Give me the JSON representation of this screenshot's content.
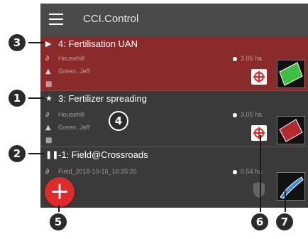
{
  "header": {
    "title": "CCI.Control",
    "menu_icon": "hamburger-menu-icon"
  },
  "tasks": [
    {
      "status_icon": "▶",
      "status_icon_name": "play-icon",
      "title": "4: Fertilisation UAN",
      "customer": "Househill",
      "worker": "Green, Jeff",
      "area": "3.05 ha",
      "selected": true,
      "background": "#8b2a2a",
      "field_color": "#3fbf3f"
    },
    {
      "status_icon": "★",
      "status_icon_name": "star-icon",
      "title": "3: Fertilizer spreading",
      "customer": "Househill",
      "worker": "Green, Jeff",
      "area": "3.05 ha",
      "selected": false,
      "background": "#3a3a3a",
      "field_color": "#b52a30"
    },
    {
      "status_icon": "❚❚",
      "status_icon_name": "pause-icon",
      "title": "-1: Field@Crossroads",
      "customer": "Field_2018-10-16_16:35:20",
      "area": "0.54 ha",
      "selected": false,
      "background": "#3a3a3a",
      "field_color": "#3a8ed8"
    }
  ],
  "fab": {
    "label": "+",
    "icon": "add-icon",
    "color": "#e02a2a"
  },
  "callouts": [
    "1",
    "2",
    "3",
    "4",
    "5",
    "6",
    "7"
  ]
}
